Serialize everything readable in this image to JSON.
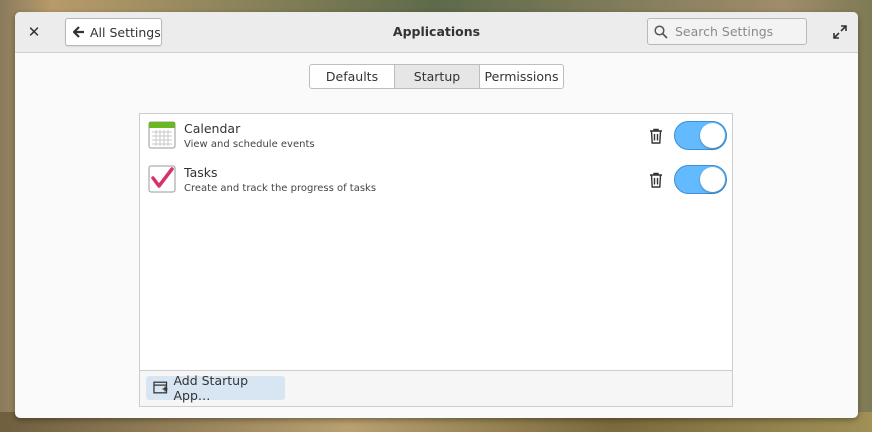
{
  "window": {
    "title": "Applications",
    "back_label": "All Settings",
    "search_placeholder": "Search Settings"
  },
  "tabs": [
    {
      "label": "Defaults",
      "active": false
    },
    {
      "label": "Startup",
      "active": true
    },
    {
      "label": "Permissions",
      "active": false
    }
  ],
  "startup_apps": [
    {
      "name": "Calendar",
      "description": "View and schedule events",
      "icon": "calendar-icon",
      "enabled": true
    },
    {
      "name": "Tasks",
      "description": "Create and track the progress of tasks",
      "icon": "tasks-checkmark-icon",
      "enabled": true
    }
  ],
  "footer": {
    "add_label": "Add Startup App…"
  },
  "colors": {
    "accent": "#64baff",
    "tasks_check": "#d6336c",
    "calendar_header": "#68b723"
  }
}
